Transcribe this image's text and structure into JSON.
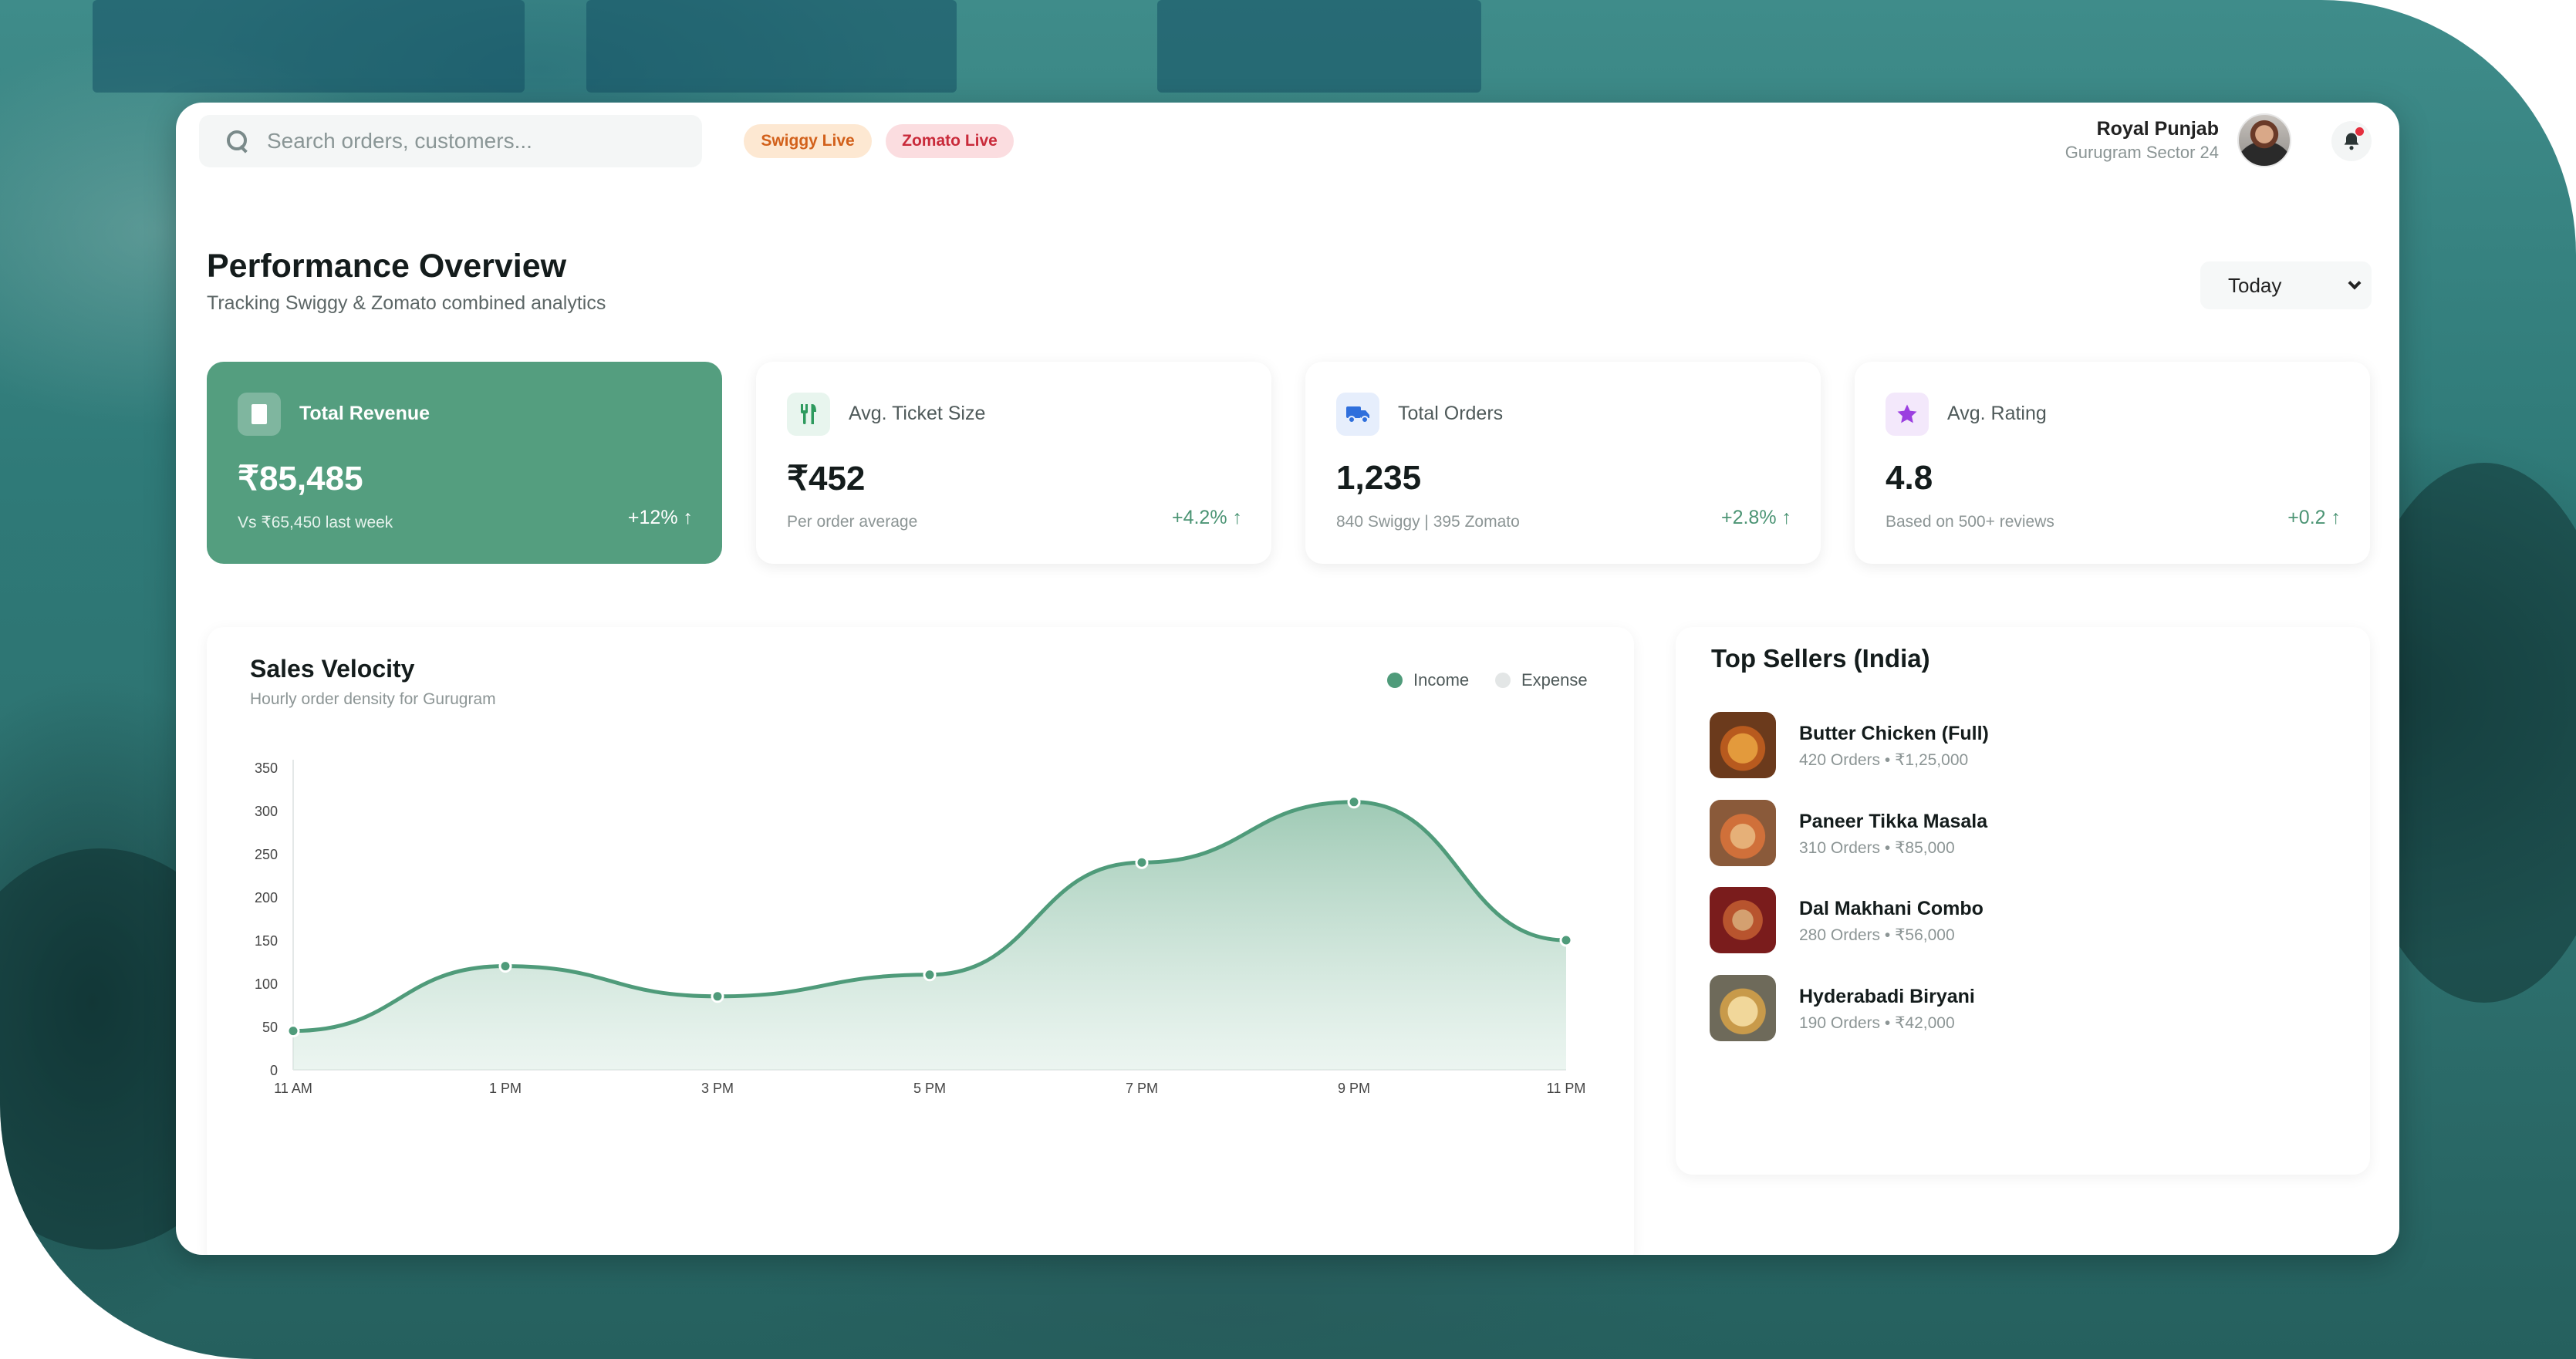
{
  "header": {
    "search_placeholder": "Search orders, customers...",
    "badges": [
      "Swiggy Live",
      "Zomato Live"
    ],
    "user": {
      "name": "Royal Punjab",
      "location": "Gurugram Sector 24"
    }
  },
  "page": {
    "title": "Performance Overview",
    "subtitle": "Tracking Swiggy & Zomato combined analytics",
    "range": "Today"
  },
  "kpis": [
    {
      "label": "Total Revenue",
      "value": "₹85,485",
      "note": "Vs ₹65,450 last week",
      "delta": "+12% ↑",
      "icon": "receipt-icon"
    },
    {
      "label": "Avg. Ticket Size",
      "value": "₹452",
      "note": "Per order average",
      "delta": "+4.2% ↑",
      "icon": "fork-knife-icon"
    },
    {
      "label": "Total Orders",
      "value": "1,235",
      "note": "840 Swiggy | 395 Zomato",
      "delta": "+2.8% ↑",
      "icon": "truck-icon"
    },
    {
      "label": "Avg. Rating",
      "value": "4.8",
      "note": "Based on 500+ reviews",
      "delta": "+0.2 ↑",
      "icon": "star-icon"
    }
  ],
  "sales": {
    "title": "Sales Velocity",
    "subtitle": "Hourly order density for Gurugram",
    "legend": [
      "Income",
      "Expense"
    ]
  },
  "chart_data": {
    "type": "area",
    "title": "Sales Velocity",
    "categories": [
      "11 AM",
      "1 PM",
      "3 PM",
      "5 PM",
      "7 PM",
      "9 PM",
      "11 PM"
    ],
    "series": [
      {
        "name": "Income",
        "values": [
          45,
          120,
          85,
          110,
          240,
          310,
          150
        ],
        "color": "#4f9b7a"
      }
    ],
    "yticks": [
      0,
      50,
      100,
      150,
      200,
      250,
      300,
      350
    ],
    "ylim": [
      0,
      350
    ],
    "grid": false,
    "legend": "top-right"
  },
  "sellers": {
    "title": "Top Sellers (India)",
    "items": [
      {
        "name": "Butter Chicken (Full)",
        "meta": "420 Orders • ₹1,25,000"
      },
      {
        "name": "Paneer Tikka Masala",
        "meta": "310 Orders • ₹85,000"
      },
      {
        "name": "Dal Makhani Combo",
        "meta": "280 Orders • ₹56,000"
      },
      {
        "name": "Hyderabadi Biryani",
        "meta": "190 Orders • ₹42,000"
      }
    ]
  },
  "colors": {
    "accent": "#549e7f",
    "swiggy": "#d2601a",
    "zomato": "#c92a3a",
    "expense": "#e3e6e6"
  }
}
